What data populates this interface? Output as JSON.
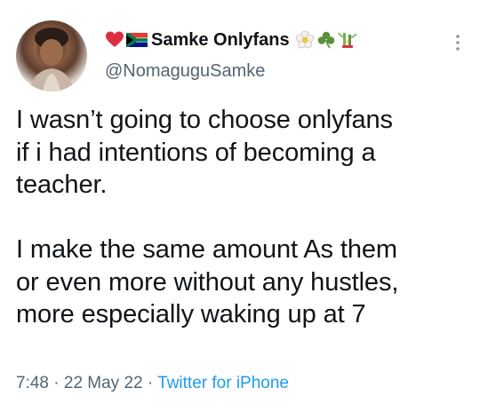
{
  "tweet": {
    "display_name": "Samke Onlyfans",
    "handle": "@NomaguguSamke",
    "emoji_before": [
      "red-heart",
      "south-africa-flag"
    ],
    "emoji_after": [
      "blossom",
      "shamrock",
      "bamboo"
    ],
    "text": "I wasn’t going to choose onlyfans\nif i had intentions of becoming a\nteacher.\n\nI make the same amount As them\nor even more without any hustles,\nmore especially waking up at 7",
    "time": "7:48",
    "separator": "·",
    "date": "22 May 22",
    "source": "Twitter for iPhone"
  },
  "colors": {
    "text": "#0f1419",
    "secondary": "#536471",
    "link": "#1d9bf0"
  }
}
